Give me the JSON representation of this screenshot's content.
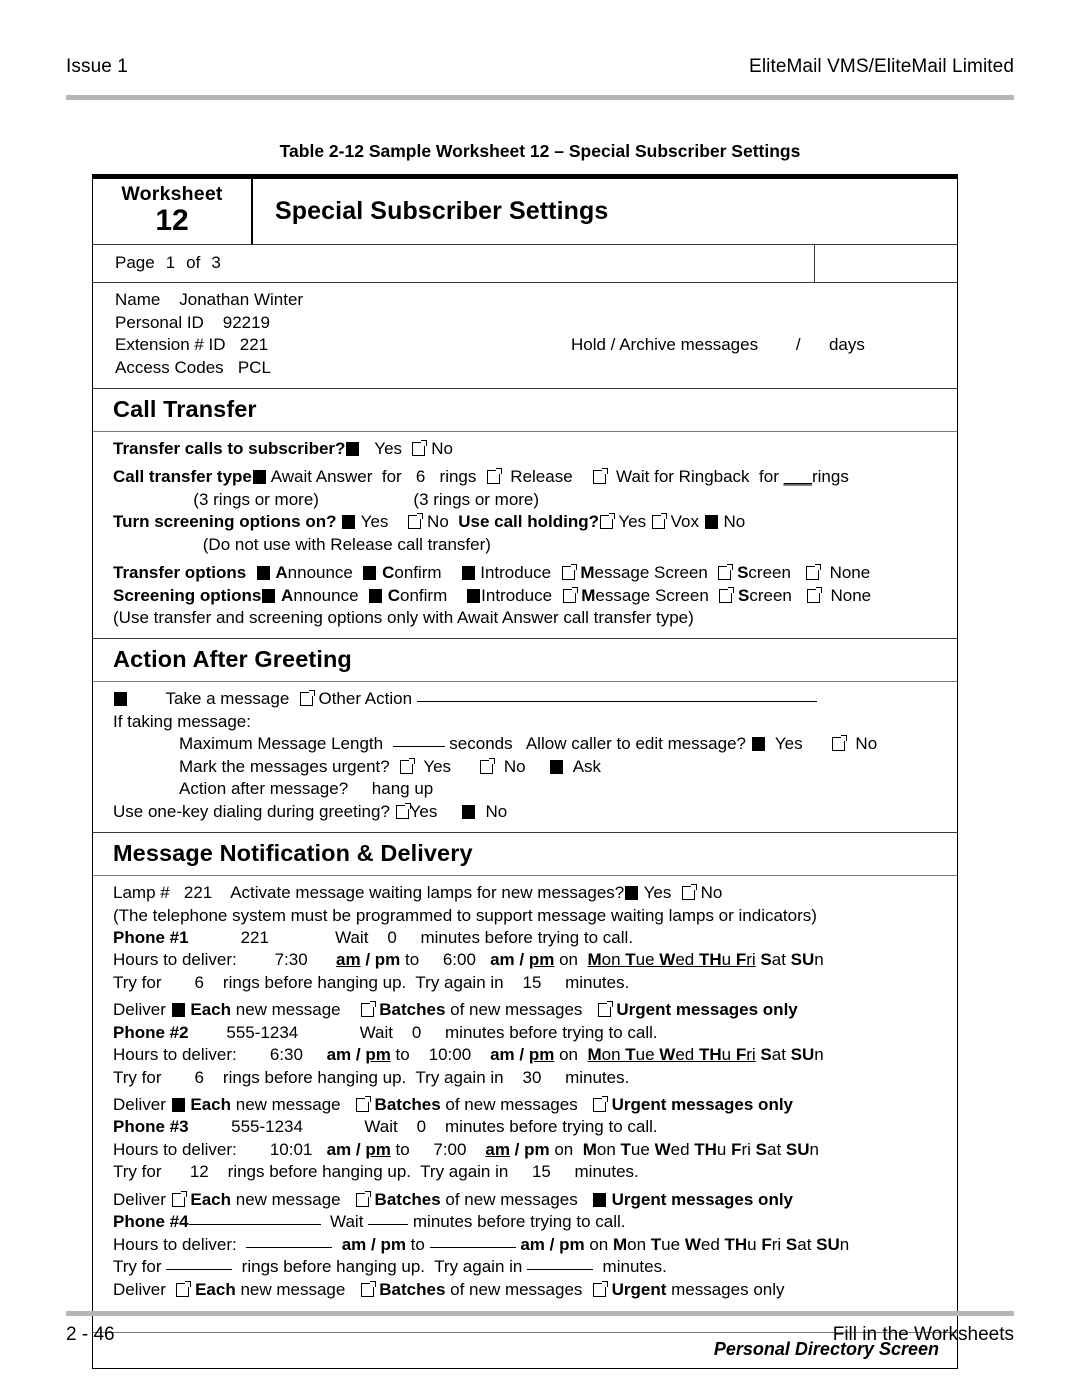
{
  "running_head": {
    "left": "Issue 1",
    "right": "EliteMail VMS/EliteMail Limited"
  },
  "table_caption": "Table 2-12  Sample Worksheet 12 – Special Subscriber Settings",
  "worksheet": {
    "number_label": "Worksheet",
    "number": "12",
    "title": "Special Subscriber Settings",
    "page_row": {
      "label": "Page",
      "current": "1",
      "of_label": "of",
      "total": "3"
    },
    "identity": {
      "name_label": "Name",
      "name_value": "Jonathan Winter",
      "personal_id_label": "Personal ID",
      "personal_id_value": "92219",
      "extension_label": "Extension # ID",
      "extension_value": "221",
      "hold_archive_label": "Hold / Archive messages",
      "hold_archive_value": "/",
      "hold_archive_unit": "days",
      "access_codes_label": "Access Codes",
      "access_codes_value": "PCL"
    },
    "call_transfer": {
      "heading": "Call Transfer",
      "transfer_calls_label": "Transfer calls to subscriber?",
      "yes_label": "Yes",
      "no_label": "No",
      "transfer_calls_yes": true,
      "transfer_calls_no": false,
      "type_label": "Call transfer type",
      "await_answer_checked": true,
      "await_answer_label": "Await Answer",
      "for_label": "for",
      "await_rings": "6",
      "rings_label": "rings",
      "release_checked": false,
      "release_label": "Release",
      "ringback_checked": false,
      "ringback_label": "Wait for Ringback",
      "ringback_for_label": "for",
      "ringback_rings_blank": "___",
      "ringback_rings_label": "rings",
      "note_left": "(3 rings or more)",
      "note_right": "(3 rings or more)",
      "screening_on_label": "Turn screening options on?",
      "screening_on_yes": true,
      "screening_on_no": false,
      "call_holding_label": "Use call holding?",
      "call_holding_yes": false,
      "call_holding_vox": false,
      "call_holding_vox_label": "Vox",
      "call_holding_no": true,
      "call_holding_note": "(Do not use with Release call transfer)",
      "transfer_options_label": "Transfer options",
      "screening_options_label": "Screening options",
      "option_announce": "Announce",
      "option_confirm": "Confirm",
      "option_introduce": "Introduce",
      "option_message_screen": "Message Screen",
      "option_screen": "Screen",
      "option_none": "None",
      "transfer_options": {
        "announce": true,
        "confirm": true,
        "introduce": true,
        "message_screen": false,
        "screen": false,
        "none": false
      },
      "screening_options": {
        "announce": true,
        "confirm": true,
        "introduce": true,
        "message_screen": false,
        "screen": false,
        "none": false
      },
      "options_note": "(Use transfer and screening options only with Await Answer call transfer type)"
    },
    "action_after_greeting": {
      "heading": "Action After Greeting",
      "take_message_checked": true,
      "take_message_label": "Take a message",
      "other_action_checked": false,
      "other_action_label": "Other Action",
      "if_taking_label": "If taking message:",
      "max_length_label": "Maximum Message Length",
      "max_length_value": "",
      "seconds_label": "seconds",
      "allow_edit_label": "Allow caller to edit message?",
      "allow_edit_yes": true,
      "allow_edit_no": false,
      "mark_urgent_label": "Mark the messages urgent?",
      "mark_urgent_yes": false,
      "mark_urgent_no": false,
      "mark_urgent_ask": true,
      "ask_label": "Ask",
      "action_after_label": "Action after message?",
      "action_after_value": "hang up",
      "one_key_label": "Use one-key dialing during greeting?",
      "one_key_yes": false,
      "one_key_no": true,
      "yes_label": "Yes",
      "no_label": "No"
    },
    "message_notification": {
      "heading": "Message Notification & Delivery",
      "lamp_label": "Lamp #",
      "lamp_value": "221",
      "activate_label": "Activate message waiting lamps for new messages?",
      "activate_yes": true,
      "activate_no": false,
      "yes_label": "Yes",
      "no_label": "No",
      "lamp_note": "(The telephone system must be programmed to support message waiting lamps or indicators)",
      "wait_label": "Wait",
      "minutes_before_label": "minutes before trying to call.",
      "hours_label": "Hours to deliver:",
      "am_label": "am",
      "pm_label": "pm",
      "to_label": "to",
      "on_label": "on",
      "try_for_label": "Try for",
      "rings_before_label": "rings before hanging up.  Try again in",
      "minutes_label": "minutes.",
      "deliver_label": "Deliver",
      "each_label": "Each",
      "each_rest": " new message",
      "batches_label": "Batches",
      "batches_rest": " of new messages",
      "urgent_label": "Urgent messages only",
      "urgent_label_split_bold": "Urgent",
      "urgent_label_split_rest": " messages only",
      "day_names": [
        "Mon",
        "Tue",
        "Wed",
        "THu",
        "Fri",
        "Sat",
        "SUn"
      ],
      "phones": [
        {
          "label": "Phone #1",
          "number": "221",
          "wait": "0",
          "start_time": "7:30",
          "start_am_underlined": true,
          "start_pm_underlined": false,
          "end_time": "6:00",
          "end_am_underlined": false,
          "end_pm_underlined": true,
          "days_selected": [
            "Mon",
            "Tue",
            "Wed",
            "THu",
            "Fri"
          ],
          "try_rings": "6",
          "try_again": "15",
          "deliver_each": true,
          "deliver_batches": false,
          "deliver_urgent": false
        },
        {
          "label": "Phone #2",
          "number": "555-1234",
          "wait": "0",
          "start_time": "6:30",
          "start_am_underlined": false,
          "start_pm_underlined": true,
          "end_time": "10:00",
          "end_am_underlined": false,
          "end_pm_underlined": true,
          "days_selected": [
            "Mon",
            "Tue",
            "Wed",
            "THu",
            "Fri"
          ],
          "try_rings": "6",
          "try_again": "30",
          "deliver_each": true,
          "deliver_batches": false,
          "deliver_urgent": false
        },
        {
          "label": "Phone #3",
          "number": "555-1234",
          "wait": "0",
          "start_time": "10:01",
          "start_am_underlined": false,
          "start_pm_underlined": true,
          "end_time": "7:00",
          "end_am_underlined": true,
          "end_pm_underlined": false,
          "days_selected": [],
          "try_rings": "12",
          "try_again": "15",
          "deliver_each": false,
          "deliver_batches": false,
          "deliver_urgent": true
        },
        {
          "label": "Phone #4",
          "number": "",
          "wait": "",
          "start_time": "",
          "start_am_underlined": false,
          "start_pm_underlined": false,
          "end_time": "",
          "end_am_underlined": false,
          "end_pm_underlined": false,
          "days_selected": [],
          "try_rings": "",
          "try_again": "",
          "deliver_each": false,
          "deliver_batches": false,
          "deliver_urgent": false
        }
      ]
    },
    "screen_name": "Personal Directory Screen"
  },
  "footer": {
    "left": "2 - 46",
    "right": "Fill in the Worksheets"
  }
}
